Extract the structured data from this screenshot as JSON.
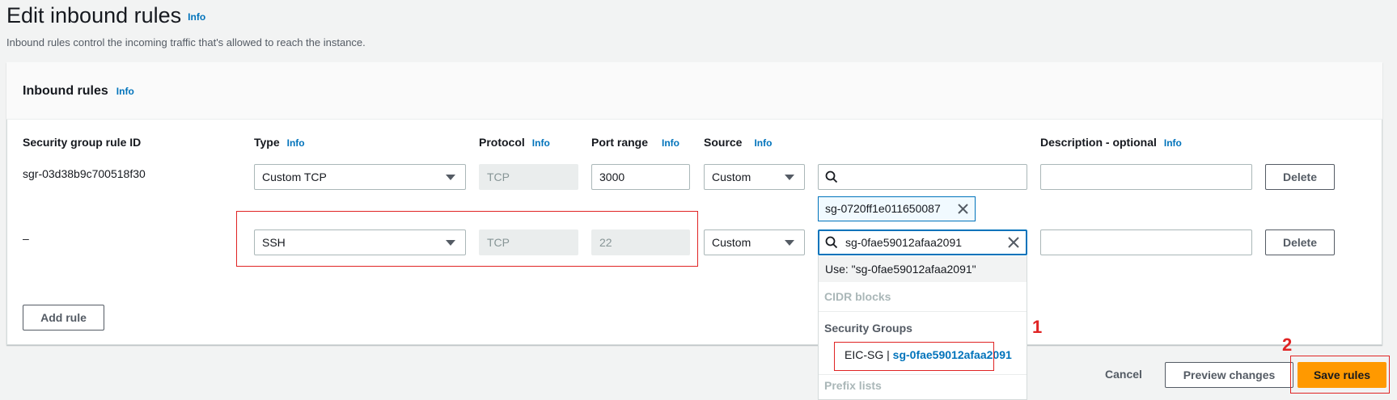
{
  "page": {
    "title": "Edit inbound rules",
    "title_info": "Info",
    "description": "Inbound rules control the incoming traffic that's allowed to reach the instance."
  },
  "panel": {
    "title": "Inbound rules",
    "title_info": "Info",
    "columns": {
      "rule_id": "Security group rule ID",
      "type": "Type",
      "protocol": "Protocol",
      "port_range": "Port range",
      "source": "Source",
      "description": "Description - optional",
      "info": "Info"
    },
    "rules": [
      {
        "id": "sgr-03d38b9c700518f30",
        "type": "Custom TCP",
        "protocol": "TCP",
        "port_range": "3000",
        "source": "Custom",
        "source_search": "",
        "token": "sg-0720ff1e011650087",
        "description": "",
        "delete_label": "Delete"
      },
      {
        "id": "–",
        "type": "SSH",
        "protocol": "TCP",
        "port_range": "22",
        "source": "Custom",
        "source_search": "sg-0fae59012afaa2091",
        "description": "",
        "delete_label": "Delete"
      }
    ],
    "add_rule_label": "Add rule"
  },
  "dropdown": {
    "use_option": "Use: \"sg-0fae59012afaa2091\"",
    "cidr_group": "CIDR blocks",
    "sg_group": "Security Groups",
    "sg_option_name": "EIC-SG | ",
    "sg_option_id": "sg-0fae59012afaa2091",
    "prefix_group": "Prefix lists"
  },
  "footer": {
    "cancel_label": "Cancel",
    "preview_label": "Preview changes",
    "save_label": "Save rules"
  },
  "annotations": {
    "step1": "1",
    "step2": "2"
  },
  "colors": {
    "accent": "#0073bb",
    "primary_button": "#ff9900",
    "annotation": "#e02424"
  }
}
